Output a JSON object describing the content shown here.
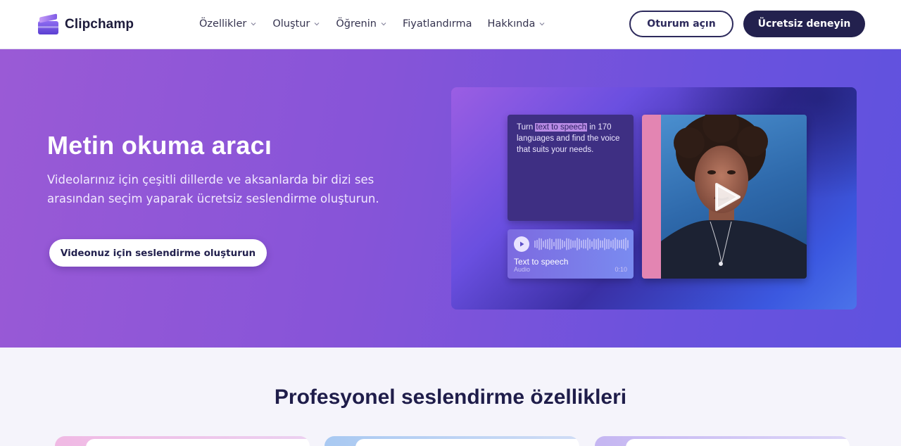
{
  "header": {
    "logo_text": "Clipchamp",
    "nav": [
      {
        "label": "Özellikler",
        "has_dropdown": true
      },
      {
        "label": "Oluştur",
        "has_dropdown": true
      },
      {
        "label": "Öğrenin",
        "has_dropdown": true
      },
      {
        "label": "Fiyatlandırma",
        "has_dropdown": false
      },
      {
        "label": "Hakkında",
        "has_dropdown": true
      }
    ],
    "signin_label": "Oturum açın",
    "try_label": "Ücretsiz deneyin"
  },
  "hero": {
    "title": "Metin okuma aracı",
    "subtitle": "Videolarınız için çeşitli dillerde ve aksanlarda bir dizi ses arasından seçim yaparak ücretsiz seslendirme oluşturun.",
    "cta_label": "Videonuz için seslendirme oluşturun",
    "media": {
      "text_card": {
        "before": "Turn ",
        "highlight": "text to speech",
        "after": " in 170 languages and find the voice that suits your needs."
      },
      "audio_card": {
        "label": "Text to speech",
        "sublabel": "Audio",
        "time": "0:10"
      }
    }
  },
  "features": {
    "title": "Profesyonel seslendirme özellikleri"
  },
  "colors": {
    "brand_dark": "#23214e",
    "hero_purple": "#8754d8",
    "accent_pink": "#e385b2"
  }
}
